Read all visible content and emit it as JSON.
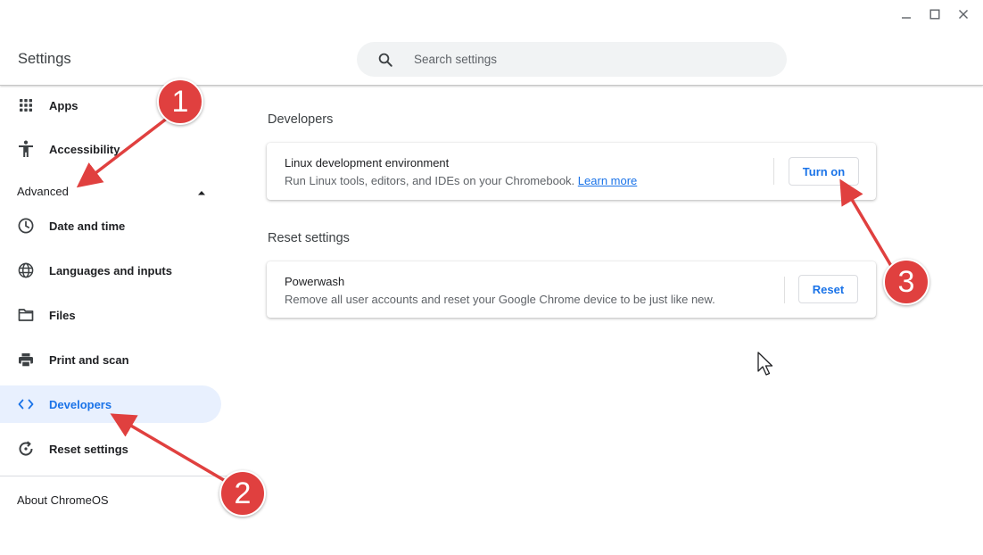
{
  "app": {
    "title": "Settings"
  },
  "window_controls": {
    "icons": [
      "minimize-icon",
      "maximize-icon",
      "close-icon"
    ]
  },
  "search": {
    "placeholder": "Search settings",
    "value": ""
  },
  "sidebar": {
    "items_top": [
      {
        "label": "Apps",
        "icon": "apps-grid-icon"
      },
      {
        "label": "Accessibility",
        "icon": "accessibility-icon"
      }
    ],
    "advanced": {
      "label": "Advanced",
      "expanded": true,
      "icon": "caret-up-icon"
    },
    "items_advanced": [
      {
        "label": "Date and time",
        "icon": "clock-icon"
      },
      {
        "label": "Languages and inputs",
        "icon": "globe-icon"
      },
      {
        "label": "Files",
        "icon": "folder-icon"
      },
      {
        "label": "Print and scan",
        "icon": "printer-icon"
      },
      {
        "label": "Developers",
        "icon": "code-brackets-icon",
        "active": true
      },
      {
        "label": "Reset settings",
        "icon": "reset-icon"
      }
    ],
    "about": "About ChromeOS"
  },
  "main": {
    "developers": {
      "heading": "Developers",
      "linux": {
        "title": "Linux development environment",
        "description": "Run Linux tools, editors, and IDEs on your Chromebook.",
        "link": "Learn more",
        "button": "Turn on"
      }
    },
    "reset": {
      "heading": "Reset settings",
      "powerwash": {
        "title": "Powerwash",
        "description": "Remove all user accounts and reset your Google Chrome device to be just like new.",
        "button": "Reset"
      }
    }
  },
  "annotations": {
    "badges": [
      "1",
      "2",
      "3"
    ],
    "color": "#e0403f"
  },
  "colors": {
    "accent": "#1a73e8",
    "active_bg": "#e8f0fe",
    "search_bg": "#f1f3f4"
  }
}
